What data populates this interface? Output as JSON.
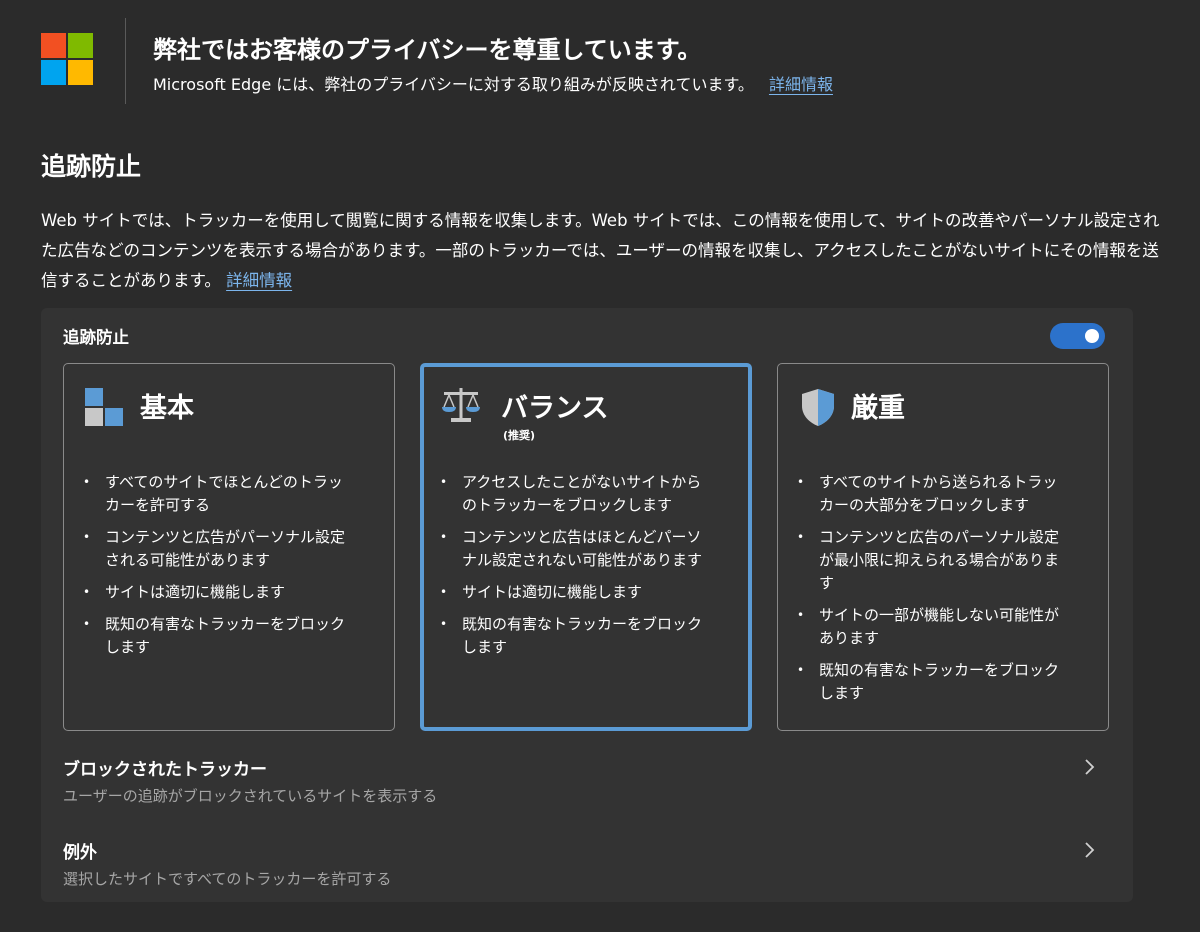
{
  "header": {
    "title": "弊社ではお客様のプライバシーを尊重しています。",
    "subtitle": "Microsoft Edge には、弊社のプライバシーに対する取り組みが反映されています。",
    "learn_more": "詳細情報",
    "logo_colors": [
      "#f25022",
      "#7fba00",
      "#00a4ef",
      "#ffb900"
    ],
    "logo_icon": "microsoft-logo"
  },
  "tracking": {
    "title": "追跡防止",
    "description": "Web サイトでは、トラッカーを使用して閲覧に関する情報を収集します。Web サイトでは、この情報を使用して、サイトの改善やパーソナル設定された広告などのコンテンツを表示する場合があります。一部のトラッカーでは、ユーザーの情報を収集し、アクセスしたことがないサイトにその情報を送信することがあります。",
    "learn_more": "詳細情報"
  },
  "panel": {
    "label": "追跡防止",
    "toggle_on": true,
    "accent_color": "#2c72cb",
    "cards": [
      {
        "title": "基本",
        "subtitle": "",
        "icon": "basic-blocks-icon",
        "selected": false,
        "bullets": [
          "すべてのサイトでほとんどのトラッカーを許可する",
          "コンテンツと広告がパーソナル設定される可能性があります",
          "サイトは適切に機能します",
          "既知の有害なトラッカーをブロックします"
        ]
      },
      {
        "title": "バランス",
        "subtitle": "(推奨)",
        "icon": "balance-scale-icon",
        "selected": true,
        "bullets": [
          "アクセスしたことがないサイトからのトラッカーをブロックします",
          "コンテンツと広告はほとんどパーソナル設定されない可能性があります",
          "サイトは適切に機能します",
          "既知の有害なトラッカーをブロックします"
        ]
      },
      {
        "title": "厳重",
        "subtitle": "",
        "icon": "shield-icon",
        "selected": false,
        "bullets": [
          "すべてのサイトから送られるトラッカーの大部分をブロックします",
          "コンテンツと広告のパーソナル設定が最小限に抑えられる場合があります",
          "サイトの一部が機能しない可能性があります",
          "既知の有害なトラッカーをブロックします"
        ]
      }
    ],
    "blocked": {
      "title": "ブロックされたトラッカー",
      "description": "ユーザーの追跡がブロックされているサイトを表示する"
    },
    "exceptions": {
      "title": "例外",
      "description": "選択したサイトですべてのトラッカーを許可する"
    }
  }
}
